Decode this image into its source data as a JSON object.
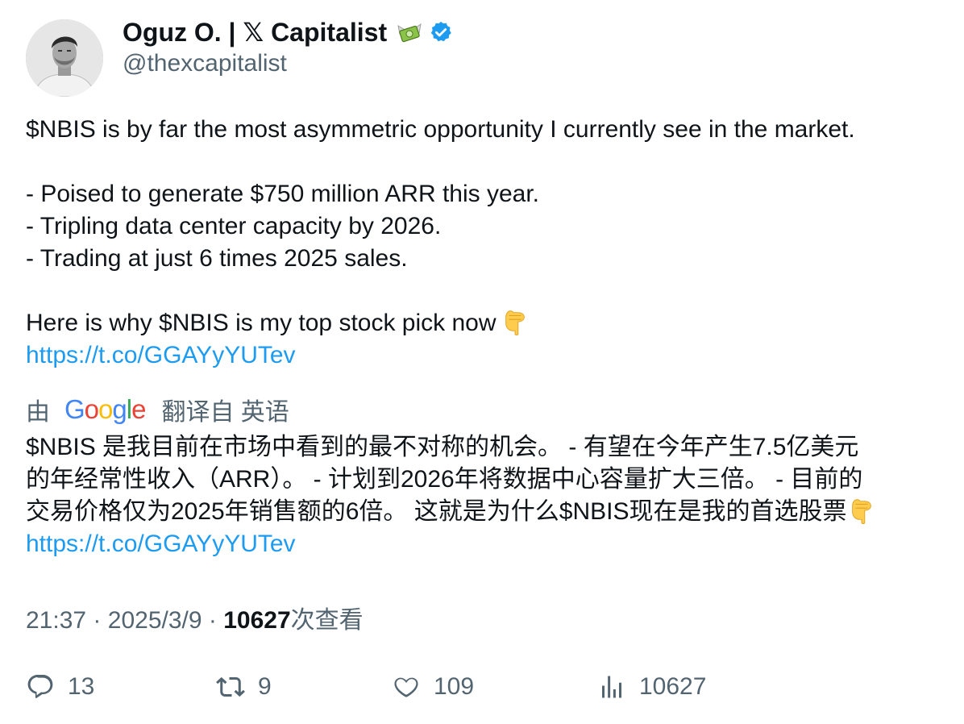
{
  "author": {
    "display_name": "Oguz O. | 𝕏 Capitalist",
    "handle": "@thexcapitalist",
    "verified": true
  },
  "tweet": {
    "line1": "$NBIS is by far the most asymmetric opportunity I currently see in the market.",
    "bullet1": "- Poised to generate $750 million ARR this year.",
    "bullet2": "- Tripling data center capacity by 2026.",
    "bullet3": "- Trading at just 6 times 2025 sales.",
    "closing": "Here is why $NBIS is my top stock pick now",
    "link": "https://t.co/GGAYyYUTev"
  },
  "translation": {
    "prefix": "由",
    "provider": "Google",
    "suffix": "翻译自 英语",
    "line1": "$NBIS 是我目前在市场中看到的最不对称的机会。 - 有望在今年产生7.5亿美元",
    "line2": "的年经常性收入（ARR）。 - 计划到2026年将数据中心容量扩大三倍。 - 目前的",
    "line3": "交易价格仅为2025年销售额的6倍。 这就是为什么$NBIS现在是我的首选股票",
    "link": "https://t.co/GGAYyYUTev"
  },
  "meta": {
    "time": "21:37",
    "separator": "·",
    "date": "2025/3/9",
    "views_count": "10627",
    "views_label": "次查看"
  },
  "actions": {
    "replies": "13",
    "reposts": "9",
    "likes": "109",
    "views": "10627"
  },
  "colors": {
    "link": "#1d9bf0",
    "secondary_text": "#536471",
    "primary_text": "#0f1419",
    "verified": "#1d9bf0"
  },
  "icons": {
    "reply": "speech-bubble-icon",
    "repost": "repost-arrows-icon",
    "like": "heart-icon",
    "views": "bar-chart-icon",
    "verified": "verified-badge-icon",
    "money": "money-with-wings-emoji",
    "point": "backhand-index-pointing-down-emoji"
  }
}
